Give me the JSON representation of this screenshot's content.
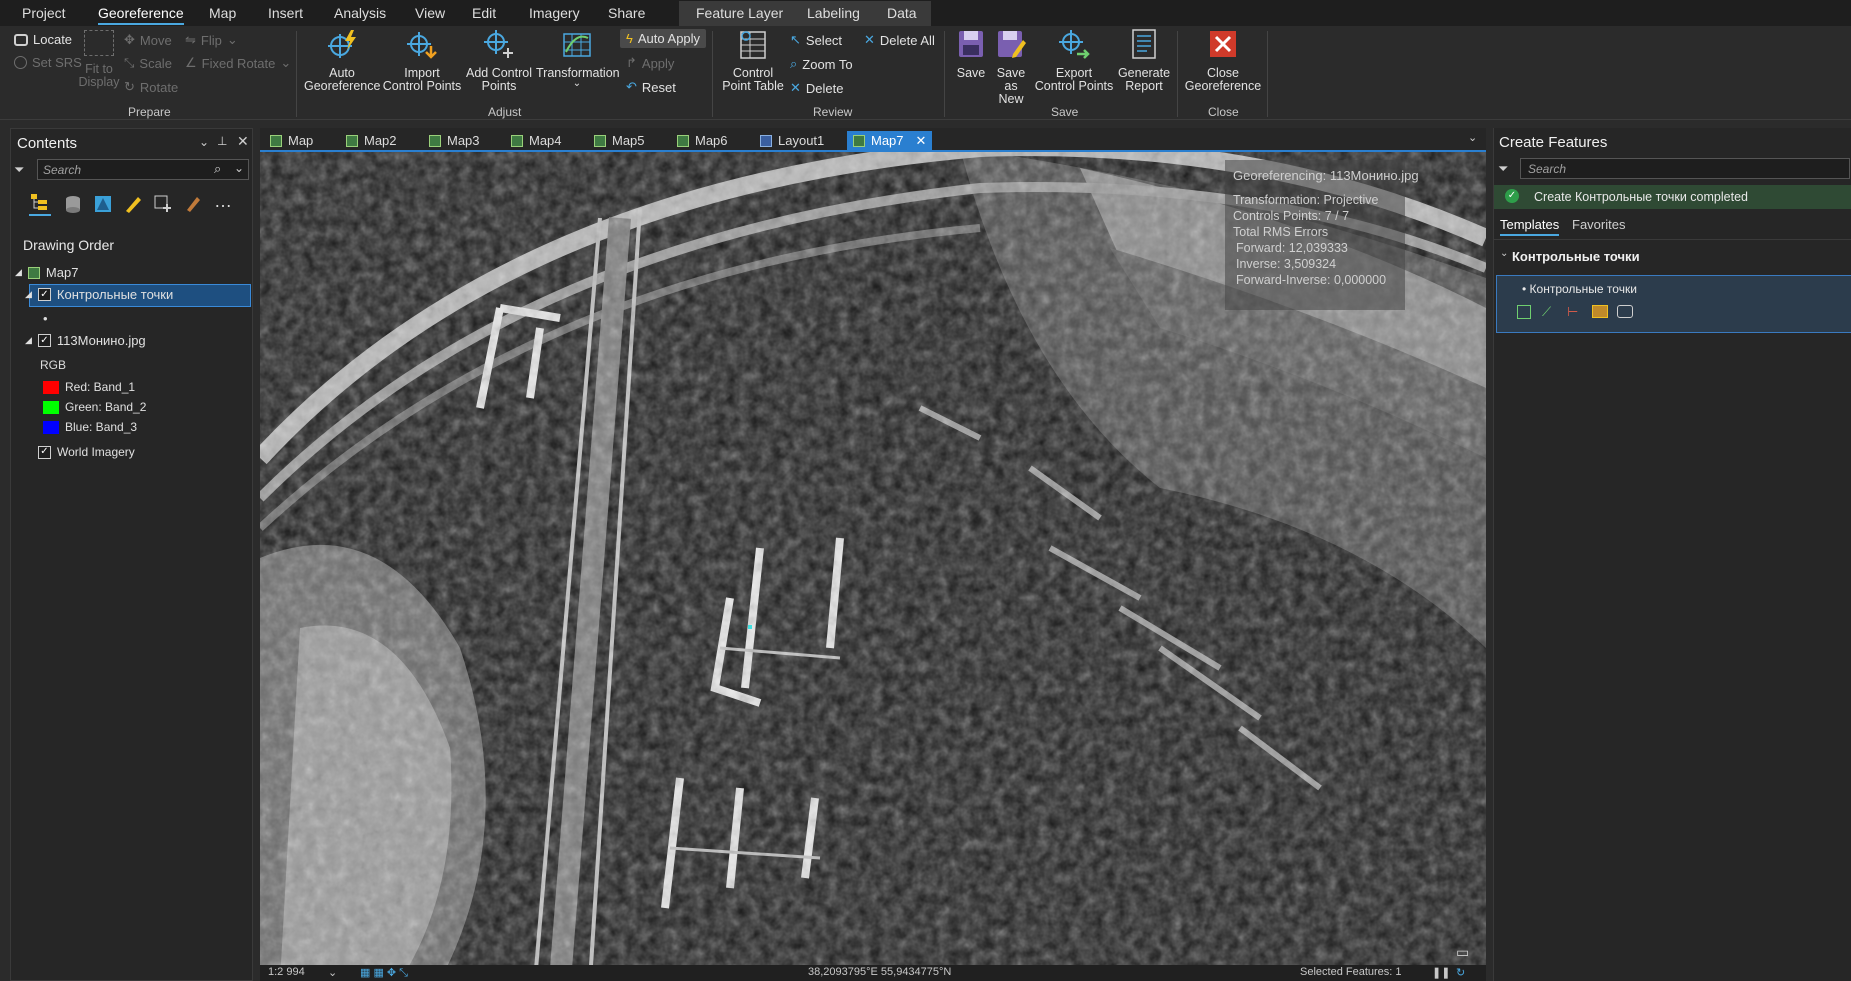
{
  "menu": {
    "tabs": [
      "Project",
      "Georeference",
      "Map",
      "Insert",
      "Analysis",
      "View",
      "Edit",
      "Imagery",
      "Share"
    ],
    "context_tabs": [
      "Feature Layer",
      "Labeling",
      "Data"
    ]
  },
  "ribbon": {
    "prepare": {
      "locate": "Locate",
      "set_srs": "Set SRS",
      "fit_to_display": "Fit to\nDisplay",
      "move": "Move",
      "scale": "Scale",
      "rotate": "Rotate",
      "flip": "Flip",
      "fixed_rotate": "Fixed Rotate",
      "label": "Prepare"
    },
    "adjust": {
      "auto_georeference": "Auto\nGeoreference",
      "import_control_points": "Import\nControl Points",
      "add_control_points": "Add Control\nPoints",
      "transformation": "Transformation",
      "auto_apply": "Auto Apply",
      "apply": "Apply",
      "reset": "Reset",
      "label": "Adjust"
    },
    "review": {
      "control_point_table": "Control\nPoint Table",
      "select": "Select",
      "zoom_to": "Zoom To",
      "delete": "Delete",
      "delete_all": "Delete All",
      "label": "Review"
    },
    "save": {
      "save": "Save",
      "save_as_new": "Save as\nNew",
      "export_control_points": "Export\nControl Points",
      "generate_report": "Generate\nReport",
      "label": "Save"
    },
    "close": {
      "close_georeference": "Close\nGeoreference",
      "label": "Close"
    }
  },
  "contents": {
    "title": "Contents",
    "search_placeholder": "Search",
    "drawing_order": "Drawing Order",
    "map_name": "Map7",
    "layer1": "Контрольные точки",
    "layer1_sub": "•",
    "layer2": "113Монино.jpg",
    "rgb": "RGB",
    "red": "Red:   Band_1",
    "green": "Green: Band_2",
    "blue": "Blue:  Band_3",
    "layer3": "World Imagery",
    "colors": {
      "red": "#ff0000",
      "green": "#00ff00",
      "blue": "#0000ff"
    }
  },
  "map_tabs": [
    "Map",
    "Map2",
    "Map3",
    "Map4",
    "Map5",
    "Map6",
    "Layout1",
    "Map7"
  ],
  "overlay": {
    "title": "Georeferencing: 113Монино.jpg",
    "transformation": "Transformation: Projective",
    "controls": "Controls Points: 7 / 7",
    "rms": "Total RMS Errors",
    "forward": "Forward: 12,039333",
    "inverse": "Inverse: 3,509324",
    "forward_inverse": "Forward-Inverse: 0,000000"
  },
  "create_features": {
    "title": "Create Features",
    "search_placeholder": "Search",
    "status": "Create Контрольные точки completed",
    "tab_templates": "Templates",
    "tab_favorites": "Favorites",
    "group": "Контрольные точки",
    "item": "Контрольные точки"
  },
  "status": {
    "scale": "1:2 994",
    "coords": "38,2093795°E 55,9434775°N",
    "selected": "Selected Features: 1"
  }
}
